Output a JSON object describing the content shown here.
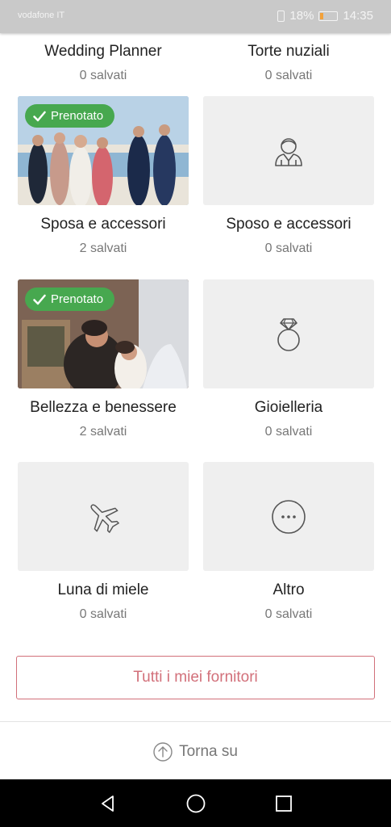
{
  "status_bar": {
    "carrier": "vodafone IT",
    "battery": "18%",
    "time": "14:35",
    "battery_level": 0.18,
    "battery_color": "#f2a13a"
  },
  "categories": [
    {
      "name": "Wedding Planner",
      "saved": "0 salvati",
      "icon": "none",
      "booked": false
    },
    {
      "name": "Torte nuziali",
      "saved": "0 salvati",
      "icon": "none",
      "booked": false
    },
    {
      "name": "Sposa e accessori",
      "saved": "2 salvati",
      "icon": "photo-wedding-party",
      "booked": true,
      "badge": "Prenotato"
    },
    {
      "name": "Sposo e accessori",
      "saved": "0 salvati",
      "icon": "groom-icon",
      "booked": false
    },
    {
      "name": "Bellezza e benessere",
      "saved": "2 salvati",
      "icon": "photo-bride-makeup",
      "booked": true,
      "badge": "Prenotato"
    },
    {
      "name": "Gioielleria",
      "saved": "0 salvati",
      "icon": "ring-icon",
      "booked": false
    },
    {
      "name": "Luna di miele",
      "saved": "0 salvati",
      "icon": "airplane-icon",
      "booked": false
    },
    {
      "name": "Altro",
      "saved": "0 salvati",
      "icon": "more-icon",
      "booked": false
    }
  ],
  "all_suppliers_button": "Tutti i miei fornitori",
  "back_to_top": "Torna su",
  "colors": {
    "accent": "#d2707a",
    "booked_badge": "#47a84f",
    "tile_bg": "#efefef"
  }
}
